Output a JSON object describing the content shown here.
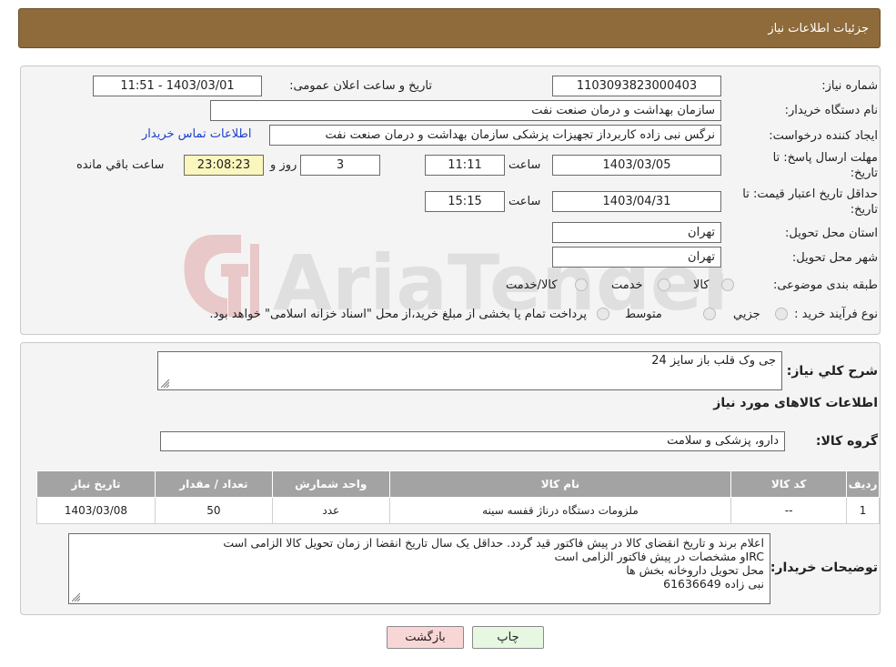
{
  "header": {
    "title": "جزئیات اطلاعات نیاز"
  },
  "fields": {
    "need_number_label": "شماره نیاز:",
    "need_number": "1103093823000403",
    "announce_label": "تاریخ و ساعت اعلان عمومی:",
    "announce_value": "1403/03/01 - 11:51",
    "buyer_org_label": "نام دستگاه خریدار:",
    "buyer_org": "سازمان بهداشت و درمان صنعت نفت",
    "requester_label": "ایجاد کننده درخواست:",
    "requester": "نرگس نبی زاده کاربرداز تجهیزات پزشکی سازمان بهداشت و درمان صنعت نفت",
    "contact_link": "اطلاعات تماس خریدار",
    "deadline_label_1": "مهلت ارسال پاسخ: تا",
    "deadline_label_2": "تاریخ:",
    "deadline_date": "1403/03/05",
    "time_label": "ساعت",
    "deadline_time": "11:11",
    "days": "3",
    "days_label": "روز و",
    "remaining_time": "23:08:23",
    "remaining_label": "ساعت باقي مانده",
    "min_validity_label_1": "حداقل تاریخ اعتبار قیمت: تا",
    "min_validity_label_2": "تاریخ:",
    "validity_date": "1403/04/31",
    "validity_time": "15:15",
    "province_label": "استان محل تحویل:",
    "province": "تهران",
    "city_label": "شهر محل تحویل:",
    "city": "تهران",
    "category_label": "طبقه بندی موضوعی:",
    "category_options": [
      "کالا",
      "خدمت",
      "کالا/خدمت"
    ],
    "process_label": "نوع فرآیند خرید :",
    "process_options": [
      "جزيي",
      "متوسط"
    ],
    "process_note": "پرداخت تمام یا بخشی از مبلغ خرید،از محل \"اسناد خزانه اسلامی\" خواهد بود."
  },
  "details": {
    "summary_label": "شرح کلي نیاز:",
    "summary": "جی وک قلب باز سایز 24",
    "items_title": "اطلاعات کالاهای مورد نیاز",
    "group_label": "گروه کالا:",
    "group": "دارو، پزشکی و سلامت",
    "table": {
      "headers": [
        "ردیف",
        "کد کالا",
        "نام کالا",
        "واحد شمارش",
        "تعداد / مقدار",
        "تاریخ نیاز"
      ],
      "rows": [
        [
          "1",
          "--",
          "ملزومات دستگاه درناژ قفسه سینه",
          "عدد",
          "50",
          "1403/03/08"
        ]
      ]
    },
    "buyer_notes_label": "توضیحات خریدار:",
    "buyer_notes": [
      "اعلام برند و تاریخ انقضای کالا در پیش فاکتور قید گردد. حداقل یک سال تاریخ انقضا از زمان تحویل کالا  الزامی است",
      "IRCو مشخصات در پیش فاکتور الزامی است",
      "محل تحویل داروخانه بخش ها",
      "نبی زاده 61636649"
    ]
  },
  "buttons": {
    "print": "چاپ",
    "back": "بازگشت"
  },
  "watermark": "AriaTender.neT",
  "colors": {
    "header": "#8f6a3a",
    "table_header": "#a3a3a3",
    "back_button": "#f9d6d6",
    "print_button": "#e6f7e2",
    "remaining_bg": "#fbf6bd",
    "link": "#1a3fd0"
  }
}
